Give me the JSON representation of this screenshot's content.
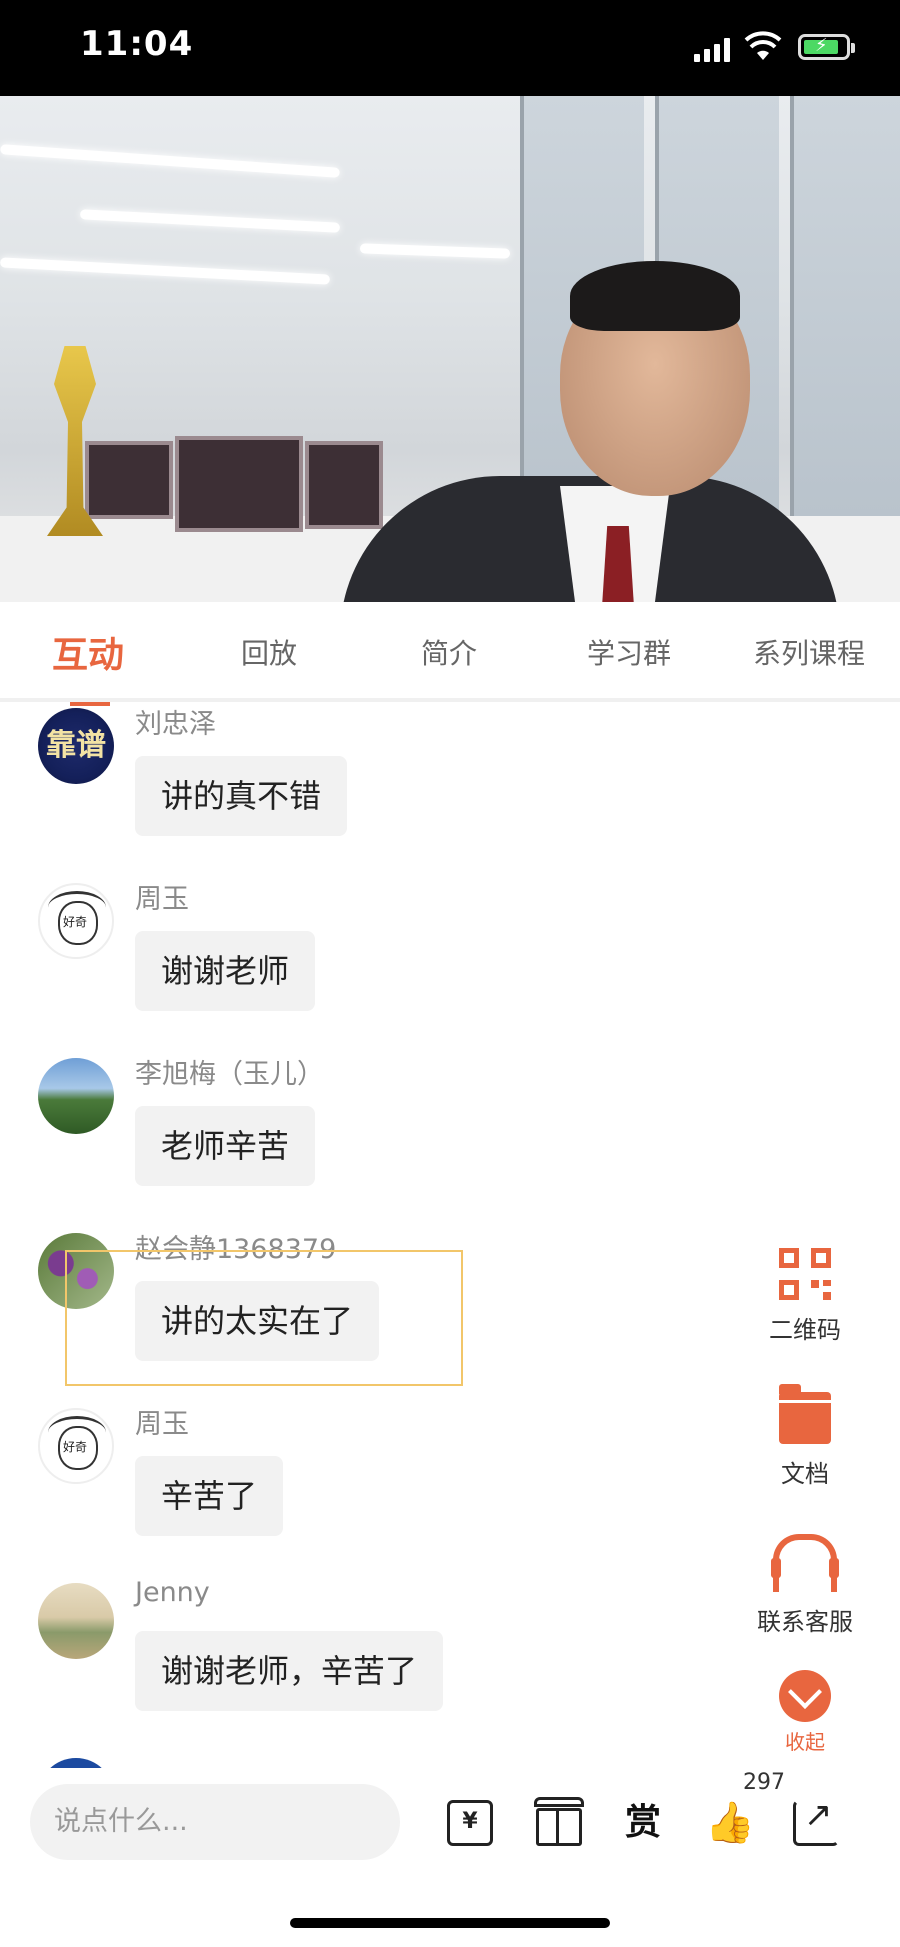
{
  "status_bar": {
    "time": "11:04"
  },
  "tabs": [
    {
      "label": "互动",
      "active": true
    },
    {
      "label": "回放"
    },
    {
      "label": "简介"
    },
    {
      "label": "学习群"
    },
    {
      "label": "系列课程"
    }
  ],
  "messages": [
    {
      "user": "刘忠泽",
      "text": "讲的真不错",
      "avatar": "book-logo"
    },
    {
      "user": "周玉",
      "text": "谢谢老师",
      "avatar": "sketch-girl"
    },
    {
      "user": "李旭梅（玉儿）",
      "text": "老师辛苦",
      "avatar": "landscape"
    },
    {
      "user": "赵会静1368379",
      "text": "讲的太实在了",
      "avatar": "flowers"
    },
    {
      "user": "周玉",
      "text": "辛苦了",
      "avatar": "sketch-girl"
    },
    {
      "user": "Jenny",
      "text": "谢谢老师，辛苦了",
      "avatar": "painting"
    }
  ],
  "side_actions": {
    "qrcode": "二维码",
    "docs": "文档",
    "support": "联系客服",
    "collapse": "收起"
  },
  "bottom_bar": {
    "input_placeholder": "说点什么...",
    "reward_label": "赏",
    "like_count": "297"
  },
  "accent_color": "#e8663f"
}
